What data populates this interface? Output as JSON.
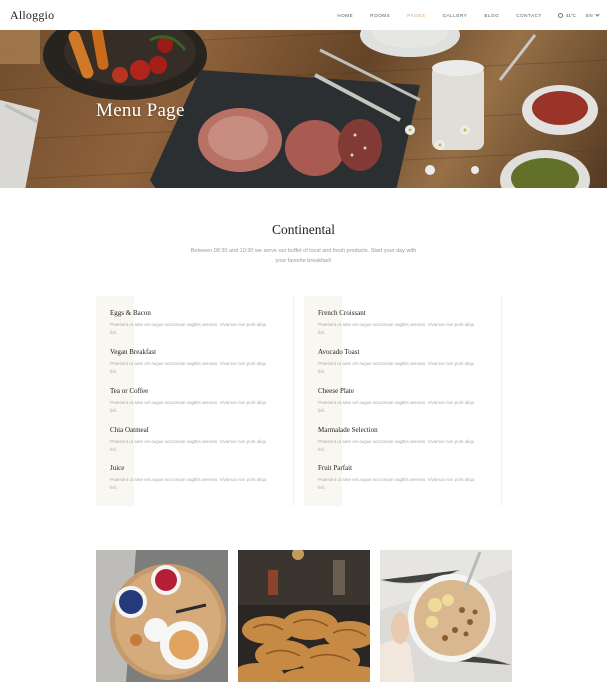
{
  "header": {
    "logo": "Alloggio",
    "nav": [
      {
        "label": "HOME"
      },
      {
        "label": "ROOMS"
      },
      {
        "label": "PAGES"
      },
      {
        "label": "GALLERY"
      },
      {
        "label": "BLOG"
      },
      {
        "label": "CONTACT"
      }
    ],
    "weather": "41°C",
    "language": "EN",
    "accent_color": "#c9a27a"
  },
  "hero": {
    "title": "Menu Page"
  },
  "section": {
    "title": "Continental",
    "intro": "Between 08:30 and 10:30 we serve our buffet of local and fresh products. Start your day with your favorite breakfast!"
  },
  "menu": {
    "left": [
      {
        "name": "Eggs & Bacon",
        "desc": "Praesent ut ante vel augue accumsan sagittis aenean. Vivamus non porti aliqu feli."
      },
      {
        "name": "Vegan Breakfast",
        "desc": "Praesent ut ante vel augue accumsan sagittis aenean. Vivamus non porti aliqu feli."
      },
      {
        "name": "Tea or Coffee",
        "desc": "Praesent ut ante vel augue accumsan sagittis aenean. Vivamus non porti aliqu feli."
      },
      {
        "name": "Chia Oatmeal",
        "desc": "Praesent ut ante vel augue accumsan sagittis aenean. Vivamus non porti aliqu feli."
      },
      {
        "name": "Juice",
        "desc": "Praesent ut ante vel augue accumsan sagittis aenean. Vivamus non porti aliqu feli."
      }
    ],
    "right": [
      {
        "name": "French Croissant",
        "desc": "Praesent ut ante vel augue accumsan sagittis aenean. Vivamus non porti aliqu feli."
      },
      {
        "name": "Avocado Toast",
        "desc": "Praesent ut ante vel augue accumsan sagittis aenean. Vivamus non porti aliqu feli."
      },
      {
        "name": "Cheese Plate",
        "desc": "Praesent ut ante vel augue accumsan sagittis aenean. Vivamus non porti aliqu feli."
      },
      {
        "name": "Marmalade Selection",
        "desc": "Praesent ut ante vel augue accumsan sagittis aenean. Vivamus non porti aliqu feli."
      },
      {
        "name": "Fruit Parfait",
        "desc": "Praesent ut ante vel augue accumsan sagittis aenean. Vivamus non porti aliqu feli."
      }
    ]
  }
}
